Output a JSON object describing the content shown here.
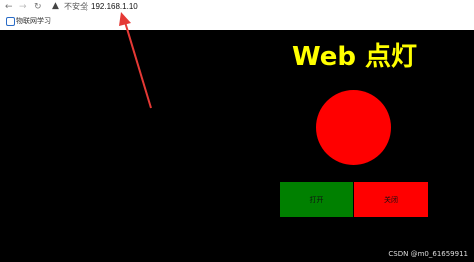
{
  "browser": {
    "nav_back": "←",
    "nav_forward": "→",
    "nav_reload": "↻",
    "warning_glyph": "▲",
    "insecure_label": "不安全",
    "url": "192.168.1.10"
  },
  "bookmarks": [
    {
      "label": "物联网学习",
      "icon": "globe-icon"
    }
  ],
  "page": {
    "title": "Web 点灯",
    "lamp_color": "#ff0000",
    "button_on_label": "打开",
    "button_on_color": "#008000",
    "button_off_label": "关闭",
    "button_off_color": "#ff0000"
  },
  "watermark": "CSDN @m0_61659911",
  "colors": {
    "background": "#000000",
    "title": "#ffff00",
    "annotation_arrow": "#e53935"
  }
}
